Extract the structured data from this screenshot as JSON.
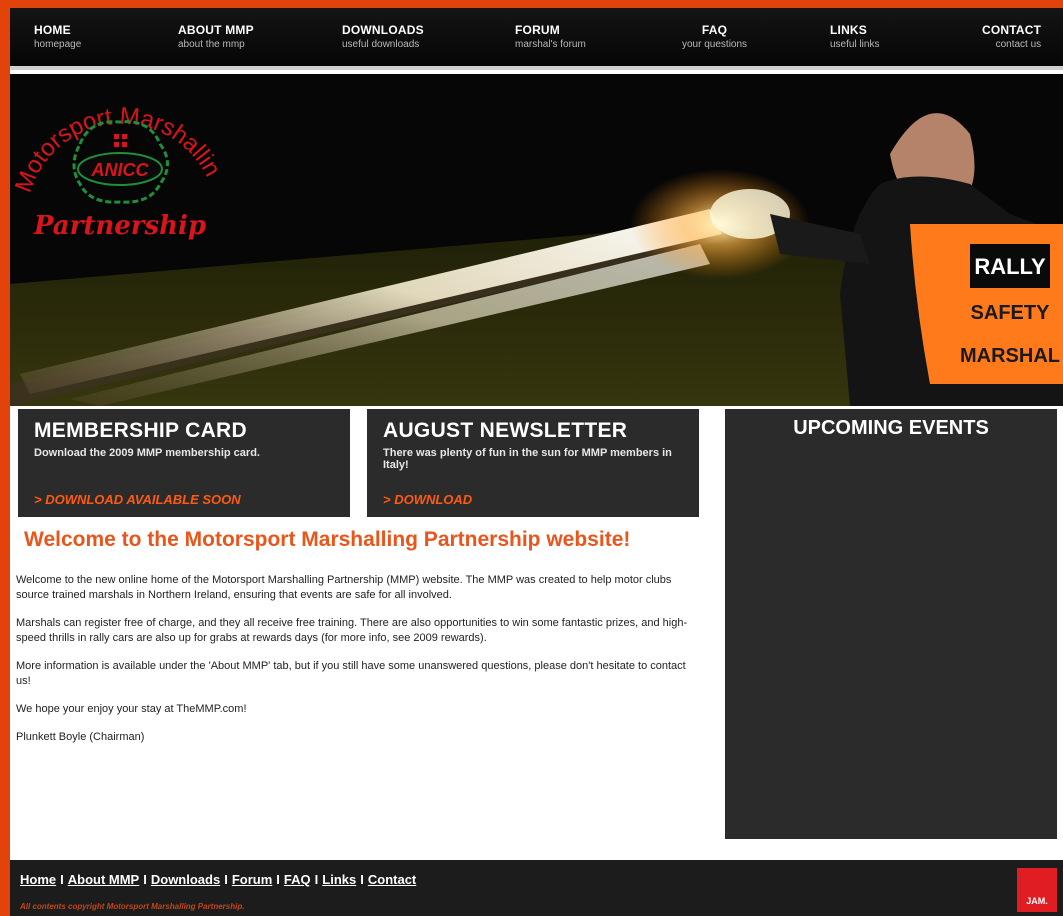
{
  "nav": {
    "items": [
      {
        "title": "HOME",
        "sub": "homepage"
      },
      {
        "title": "ABOUT MMP",
        "sub": "about the mmp"
      },
      {
        "title": "DOWNLOADS",
        "sub": "useful downloads"
      },
      {
        "title": "FORUM",
        "sub": "marshal's forum"
      },
      {
        "title": "FAQ",
        "sub": "your questions"
      },
      {
        "title": "LINKS",
        "sub": "useful links"
      },
      {
        "title": "CONTACT",
        "sub": "contact us"
      }
    ]
  },
  "logo": {
    "arc_text": "Motorsport Marshalling",
    "center_text": "ANICC",
    "script_text": "Partnership"
  },
  "hero": {
    "vest_line1": "RALLY",
    "vest_line2": "SAFETY",
    "vest_line3": "MARSHAL"
  },
  "cards": {
    "membership": {
      "title": "MEMBERSHIP CARD",
      "text": "Download the 2009 MMP membership card.",
      "link": "> DOWNLOAD AVAILABLE SOON"
    },
    "newsletter": {
      "title": "AUGUST NEWSLETTER",
      "text": "There was plenty of fun in the sun for MMP members in Italy!",
      "link": "> DOWNLOAD"
    }
  },
  "events": {
    "title": "UPCOMING EVENTS"
  },
  "main": {
    "heading": "Welcome to the Motorsport Marshalling Partnership website!",
    "paragraphs": [
      "Welcome to the new online home of the Motorsport Marshalling Partnership (MMP) website. The MMP was created to help motor clubs source trained marshals in Northern Ireland, ensuring that events are safe for all involved.",
      "Marshals can register free of charge, and they all receive free training. There are also opportunities to win some fantastic prizes, and high-speed thrills in rally cars are also up for grabs at rewards days (for more info, see 2009 rewards).",
      "More information is available under the 'About MMP' tab, but if you still have some unanswered questions, please don't hesitate to contact us!",
      "We hope your enjoy your stay at TheMMP.com!",
      "Plunkett Boyle (Chairman)"
    ]
  },
  "footer": {
    "links": [
      "Home",
      "About MMP",
      "Downloads",
      "Forum",
      "FAQ",
      "Links",
      "Contact"
    ],
    "separator": "I",
    "copyright": "All contents copyright Motorsport Marshalling Partnership.",
    "badge": "JAM."
  },
  "colors": {
    "page_border": "#e2430b",
    "accent_orange": "#e9561c",
    "dark_panel": "#2b2b2b",
    "logo_red": "#d8151b"
  }
}
